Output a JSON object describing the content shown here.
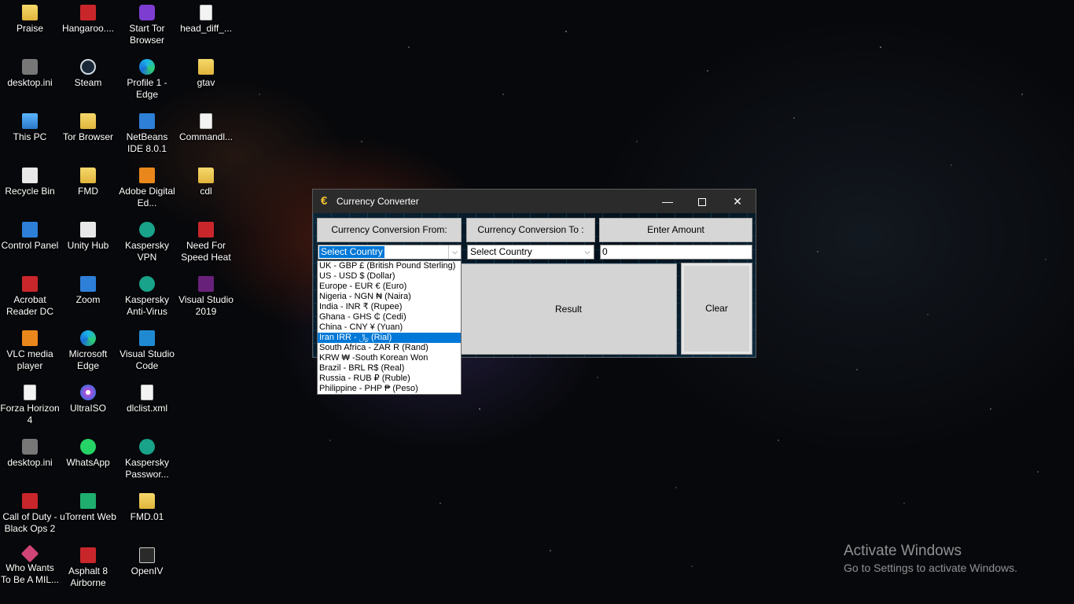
{
  "desktop": {
    "icons": [
      {
        "label": "Praise",
        "icon": "folder-icon"
      },
      {
        "label": "Hangaroo....",
        "icon": "game-icon"
      },
      {
        "label": "Start Tor Browser",
        "icon": "tor-icon"
      },
      {
        "label": "head_diff_...",
        "icon": "file-icon"
      },
      {
        "label": "desktop.ini",
        "icon": "settings-file-icon"
      },
      {
        "label": "Steam",
        "icon": "steam-icon"
      },
      {
        "label": "Profile 1 - Edge",
        "icon": "edge-icon"
      },
      {
        "label": "gtav",
        "icon": "folder-icon"
      },
      {
        "label": "This PC",
        "icon": "computer-icon"
      },
      {
        "label": "Tor Browser",
        "icon": "folder-icon"
      },
      {
        "label": "NetBeans IDE 8.0.1",
        "icon": "netbeans-icon"
      },
      {
        "label": "Commandl...",
        "icon": "file-icon"
      },
      {
        "label": "Recycle Bin",
        "icon": "recycle-bin-icon"
      },
      {
        "label": "FMD",
        "icon": "folder-icon"
      },
      {
        "label": "Adobe Digital Ed...",
        "icon": "adobe-icon"
      },
      {
        "label": "cdl",
        "icon": "folder-icon"
      },
      {
        "label": "Control Panel",
        "icon": "control-panel-icon"
      },
      {
        "label": "Unity Hub",
        "icon": "unity-icon"
      },
      {
        "label": "Kaspersky VPN",
        "icon": "kaspersky-icon"
      },
      {
        "label": "Need For Speed Heat",
        "icon": "game-icon"
      },
      {
        "label": "Acrobat Reader DC",
        "icon": "acrobat-icon"
      },
      {
        "label": "Zoom",
        "icon": "zoom-icon"
      },
      {
        "label": "Kaspersky Anti-Virus",
        "icon": "kaspersky-icon"
      },
      {
        "label": "Visual Studio 2019",
        "icon": "visual-studio-icon"
      },
      {
        "label": "VLC media player",
        "icon": "vlc-icon"
      },
      {
        "label": "Microsoft Edge",
        "icon": "edge-icon"
      },
      {
        "label": "Visual Studio Code",
        "icon": "vscode-icon"
      },
      {
        "label": "Forza Horizon 4",
        "icon": "file-icon"
      },
      {
        "label": "UltraISO",
        "icon": "disc-icon"
      },
      {
        "label": "dlclist.xml",
        "icon": "xml-file-icon"
      },
      {
        "label": "desktop.ini",
        "icon": "settings-file-icon"
      },
      {
        "label": "WhatsApp",
        "icon": "whatsapp-icon"
      },
      {
        "label": "Kaspersky Passwor...",
        "icon": "kaspersky-icon"
      },
      {
        "label": "Call of Duty - Black Ops 2",
        "icon": "game-icon"
      },
      {
        "label": "uTorrent Web",
        "icon": "utorrent-icon"
      },
      {
        "label": "FMD.01",
        "icon": "folder-icon"
      },
      {
        "label": "Who Wants To Be A MIL...",
        "icon": "game-icon"
      },
      {
        "label": "Asphalt 8 Airborne",
        "icon": "game-icon"
      },
      {
        "label": "OpenIV",
        "icon": "openiv-icon"
      }
    ]
  },
  "window": {
    "title": "Currency Converter",
    "icon": "euro-icon",
    "min_glyph": "—",
    "close_glyph": "✕",
    "from_label": "Currency Conversion From:",
    "to_label": "Currency Conversion To :",
    "amount_label": "Enter Amount",
    "from_value": "Select Country",
    "to_value": "Select Country",
    "amount_value": "0",
    "result_label": "Result",
    "clear_label": "Clear",
    "arrow_glyph": "⌵"
  },
  "dropdown": {
    "selected_index": 7,
    "options": [
      "UK - GBP £ (British Pound Sterling)",
      "US - USD $ (Dollar)",
      "Europe - EUR € (Euro)",
      "Nigeria - NGN ₦ (Naira)",
      "India - INR ₹ (Rupee)",
      "Ghana - GHS ₵ (Cedi)",
      "China - CNY ¥ (Yuan)",
      "Iran IRR - ﷼ (Rial)",
      "South Africa - ZAR R (Rand)",
      "KRW ₩ -South Korean Won",
      "Brazil - BRL R$ (Real)",
      "Russia - RUB ₽ (Ruble)",
      "Philippine - PHP ₱ (Peso)"
    ]
  },
  "watermark": {
    "line1": "Activate Windows",
    "line2": "Go to Settings to activate Windows."
  }
}
